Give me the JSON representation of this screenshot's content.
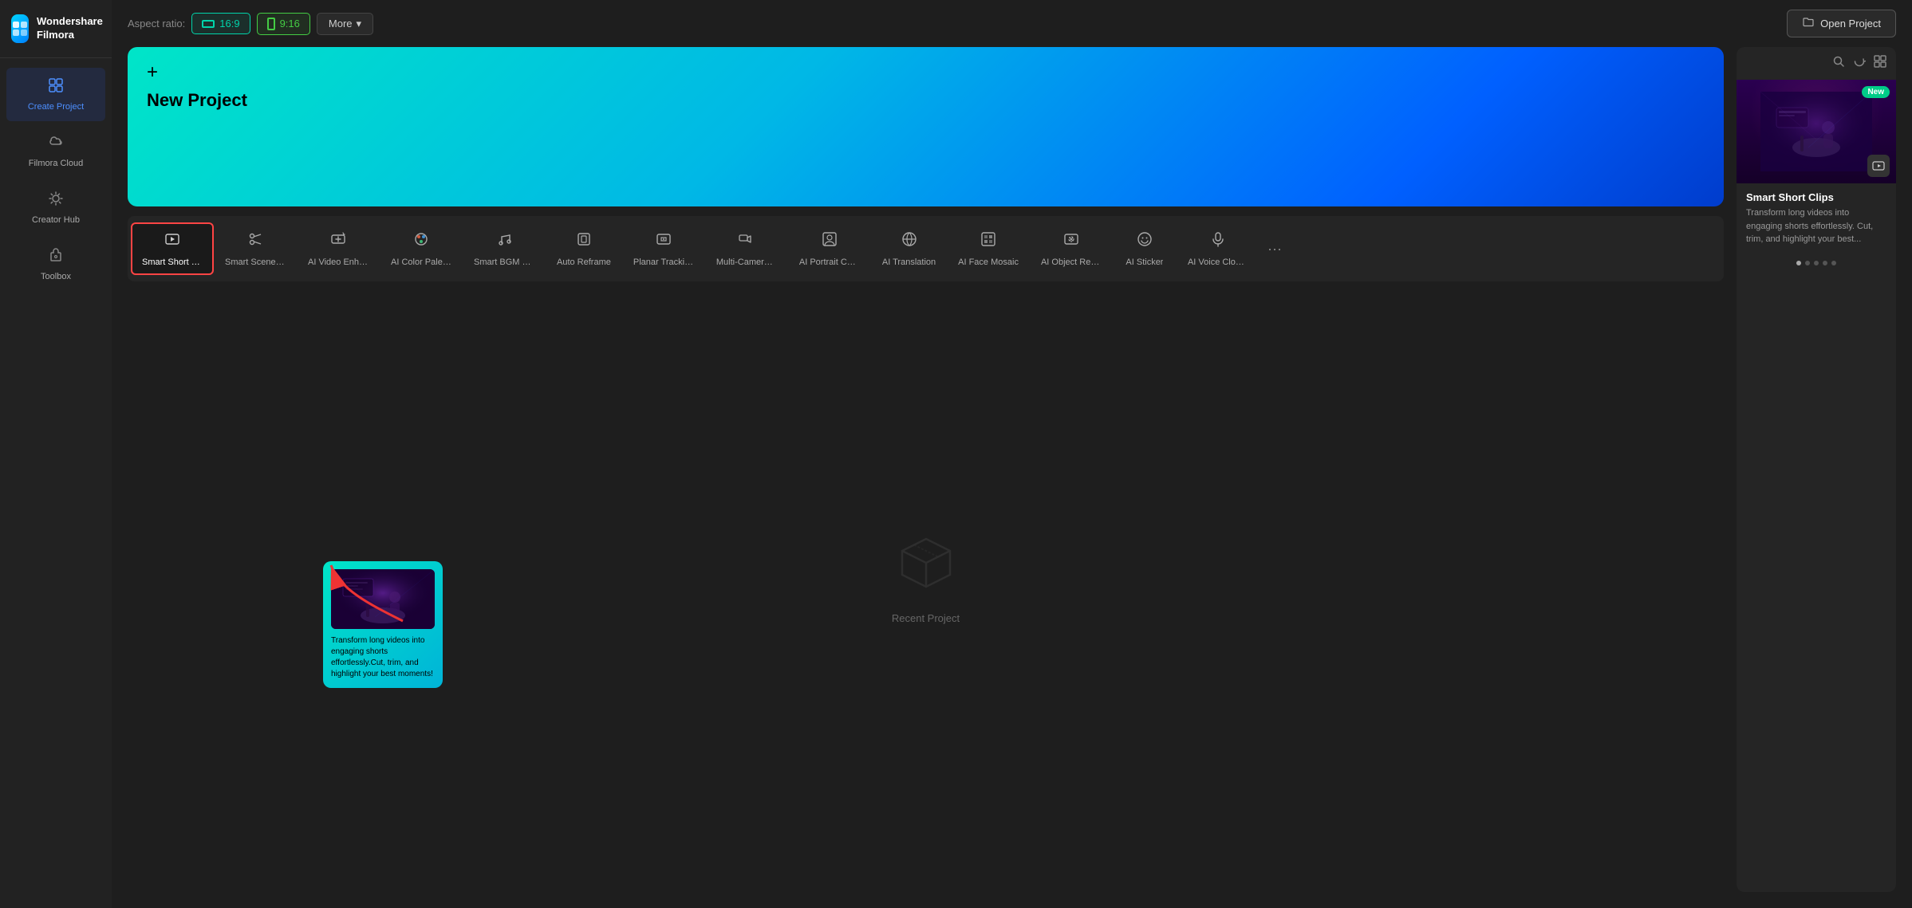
{
  "app": {
    "name": "Wondershare",
    "product": "Filmora"
  },
  "sidebar": {
    "items": [
      {
        "id": "create-project",
        "label": "Create Project",
        "icon": "⊞",
        "active": true
      },
      {
        "id": "filmora-cloud",
        "label": "Filmora Cloud",
        "icon": "☁",
        "active": false
      },
      {
        "id": "creator-hub",
        "label": "Creator Hub",
        "icon": "◈",
        "active": false
      },
      {
        "id": "toolbox",
        "label": "Toolbox",
        "icon": "⊙",
        "active": false
      }
    ]
  },
  "topbar": {
    "aspect_label": "Aspect ratio:",
    "btn_169": "16:9",
    "btn_916": "9:16",
    "btn_more": "More",
    "btn_open": "Open Project"
  },
  "banner": {
    "plus": "+",
    "title": "New Project"
  },
  "tools": [
    {
      "id": "smart-short-clips",
      "label": "Smart Short Cli...",
      "icon": "✂",
      "selected": true
    },
    {
      "id": "smart-scene-cut",
      "label": "Smart Scene Cut",
      "icon": "⧗"
    },
    {
      "id": "ai-video-enhance",
      "label": "AI Video Enhan...",
      "icon": "✦"
    },
    {
      "id": "ai-color-palette",
      "label": "AI Color Palette",
      "icon": "◉"
    },
    {
      "id": "smart-bgm-gen",
      "label": "Smart BGM Ge...",
      "icon": "♪"
    },
    {
      "id": "auto-reframe",
      "label": "Auto Reframe",
      "icon": "⊡"
    },
    {
      "id": "planar-tracking",
      "label": "Planar Tracking",
      "icon": "⊞"
    },
    {
      "id": "multi-camera",
      "label": "Multi-Camera ...",
      "icon": "⊟"
    },
    {
      "id": "ai-portrait-cut",
      "label": "AI Portrait Cut...",
      "icon": "⊛"
    },
    {
      "id": "ai-translation",
      "label": "AI Translation",
      "icon": "⊕"
    },
    {
      "id": "ai-face-mosaic",
      "label": "AI Face Mosaic",
      "icon": "⊠"
    },
    {
      "id": "ai-object-rem",
      "label": "AI Object Rem...",
      "icon": "◈"
    },
    {
      "id": "ai-sticker",
      "label": "AI Sticker",
      "icon": "⊚"
    },
    {
      "id": "ai-voice-cloning",
      "label": "AI Voice Cloning",
      "icon": "⊜"
    }
  ],
  "tooltip": {
    "desc": "Transform long videos into engaging shorts effortlessly.Cut, trim, and highlight your best moments!"
  },
  "right_card": {
    "new_badge": "New",
    "title": "Smart Short Clips",
    "desc": "Transform long videos into engaging shorts effortlessly. Cut, trim, and highlight your best..."
  },
  "recent": {
    "empty_text": "Recent Project"
  }
}
